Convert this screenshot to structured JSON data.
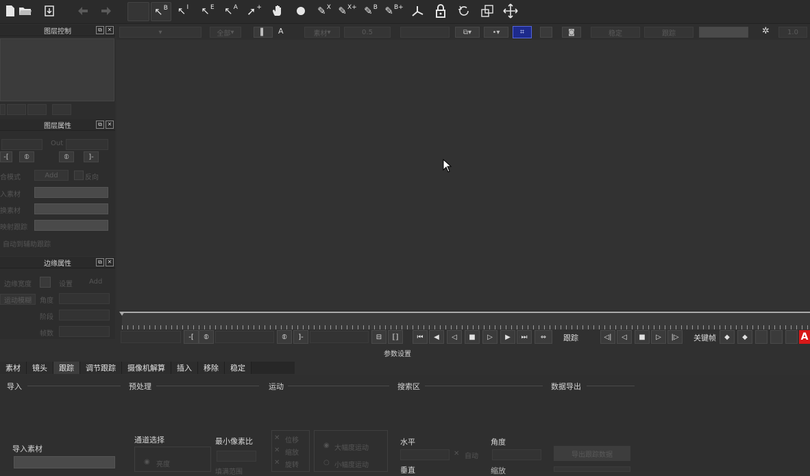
{
  "toolbar": {
    "tools": [
      {
        "icon": "new-file-icon",
        "glyph": "🗋"
      },
      {
        "icon": "open-folder-icon",
        "glyph": "📂"
      },
      {
        "icon": "save-icon",
        "glyph": "⤓"
      },
      {
        "icon": "back-arrow-icon",
        "glyph": "◀"
      },
      {
        "icon": "forward-arrow-icon",
        "glyph": "▶"
      },
      {
        "icon": "select-b-icon",
        "label": "B"
      },
      {
        "icon": "select-i-icon",
        "label": "I"
      },
      {
        "icon": "select-e-icon",
        "label": "E"
      },
      {
        "icon": "select-a-icon",
        "label": "A"
      },
      {
        "icon": "add-point-icon",
        "label": "+"
      },
      {
        "icon": "hand-icon",
        "glyph": "✋"
      },
      {
        "icon": "circle-dot-icon",
        "glyph": "●"
      },
      {
        "icon": "pen-x-icon",
        "label": "X"
      },
      {
        "icon": "pen-x-plus-icon",
        "label": "X+"
      },
      {
        "icon": "pen-b-icon",
        "label": "B"
      },
      {
        "icon": "pen-b-plus-icon",
        "label": "B+"
      },
      {
        "icon": "split-icon",
        "glyph": "⅄"
      },
      {
        "icon": "lock-icon",
        "glyph": "🔓"
      },
      {
        "icon": "rotate-icon",
        "glyph": "⟲"
      },
      {
        "icon": "scale-icon",
        "glyph": "⧉"
      },
      {
        "icon": "move-icon",
        "glyph": "✥"
      }
    ]
  },
  "panels": {
    "layer_control": {
      "title": "图层控制"
    },
    "layer_properties": {
      "title": "图层属性",
      "out_label": "Out",
      "blend_mode_label": "合模式",
      "blend_value": "Add",
      "invert_label": "反向",
      "rows": [
        "入素材",
        "换素材",
        "映射跟踪"
      ],
      "auto_label": "自动到辅助跟踪"
    },
    "edge_properties": {
      "title": "边缘属性",
      "edge_width_label": "边缘宽度",
      "settings_label": "设置",
      "add_label": "Add",
      "motion_blur_label": "运动模糊",
      "angle_label": "角度",
      "phase_label": "阶段",
      "frame_label": "帧数"
    }
  },
  "viewbar": {
    "all_label": "全部",
    "a_label": "A",
    "display_label": "素材",
    "opacity_value": "0.5",
    "stabilize_label": "稳定",
    "track_label": "跟踪",
    "value_right": "1.0"
  },
  "transport": {
    "track_label": "跟踪",
    "keyframe_label": "关键帧",
    "param_label": "参数设置"
  },
  "tabs": [
    "素材",
    "镜头",
    "跟踪",
    "调节跟踪",
    "摄像机解算",
    "插入",
    "移除",
    "稳定"
  ],
  "active_tab": 2,
  "sections": {
    "import": "导入",
    "preprocess": "预处理",
    "motion": "运动",
    "search": "搜索区",
    "export": "数据导出"
  },
  "track_params": {
    "import_footage": "导入素材",
    "channel_select": "通道选择",
    "min_pixel_ratio": "最小像素比",
    "checkbox_shift": "位移",
    "checkbox_scale": "缩放",
    "checkbox_rotate": "旋转",
    "radio_large": "大幅度运动",
    "radio_small": "小幅度运动",
    "channel_value": "亮度",
    "horizontal": "水平",
    "angle": "角度",
    "auto": "自动",
    "vertical": "垂直",
    "zoom": "缩放",
    "export_button": "导出跟踪数据",
    "fill_label": "填满范围"
  }
}
